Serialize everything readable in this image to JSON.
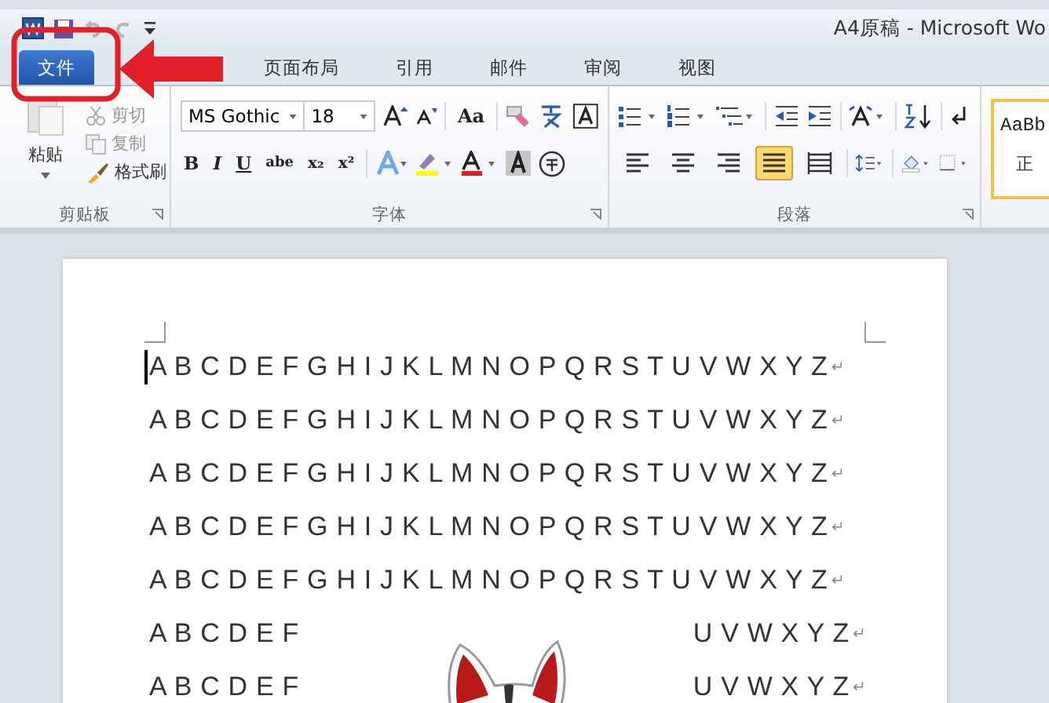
{
  "window": {
    "title": "A4原稿 - Microsoft Wo"
  },
  "tabs": [
    {
      "label": "文件",
      "kind": "file",
      "selected": false
    },
    {
      "label": "页面布局",
      "kind": "tab",
      "selected": false
    },
    {
      "label": "引用",
      "kind": "tab",
      "selected": false
    },
    {
      "label": "邮件",
      "kind": "tab",
      "selected": false
    },
    {
      "label": "审阅",
      "kind": "tab",
      "selected": false
    },
    {
      "label": "视图",
      "kind": "tab",
      "selected": false
    }
  ],
  "clipboard": {
    "paste": "粘贴",
    "items": [
      {
        "label": "剪切",
        "kind": "cut"
      },
      {
        "label": "复制",
        "kind": "copy"
      },
      {
        "label": "格式刷",
        "kind": "brush"
      }
    ],
    "group_label": "剪贴板"
  },
  "font": {
    "name": "MS Gothic",
    "size": "18",
    "case_button": "Aa",
    "format_buttons": [
      "B",
      "I",
      "U",
      "abe",
      "x₂",
      "x²"
    ],
    "group_label": "字体"
  },
  "paragraph": {
    "group_label": "段落",
    "alignments": [
      {
        "kind": "left",
        "selected": false
      },
      {
        "kind": "center",
        "selected": false
      },
      {
        "kind": "right",
        "selected": false
      },
      {
        "kind": "justify",
        "selected": true
      },
      {
        "kind": "distributed",
        "selected": false
      }
    ]
  },
  "styles": {
    "preview": "AaBb",
    "name": "正"
  },
  "document": {
    "lines": [
      {
        "left": "A B C D E F G H I J K L M N O P Q R S T U V W X Y Z",
        "mark": "↵",
        "cursor": true
      },
      {
        "left": "A B C D E F G H I J K L M N O P Q R S T U V W X Y Z",
        "mark": "↵",
        "cursor": false
      },
      {
        "left": "A B C D E F G H I J K L M N O P Q R S T U V W X Y Z",
        "mark": "↵",
        "cursor": false
      },
      {
        "left": "A B C D E F G H I J K L M N O P Q R S T U V W X Y Z",
        "mark": "↵",
        "cursor": false
      },
      {
        "left": "A B C D E F G H I J K L M N O P Q R S T U V W X Y Z",
        "mark": "↵",
        "cursor": false
      },
      {
        "left": "A B C D E F",
        "right": "U V W X Y Z",
        "mark": "↵",
        "cursor": false
      },
      {
        "left": "A B C D E F",
        "right": "U V W X Y Z",
        "mark": "↵",
        "cursor": false
      }
    ]
  }
}
